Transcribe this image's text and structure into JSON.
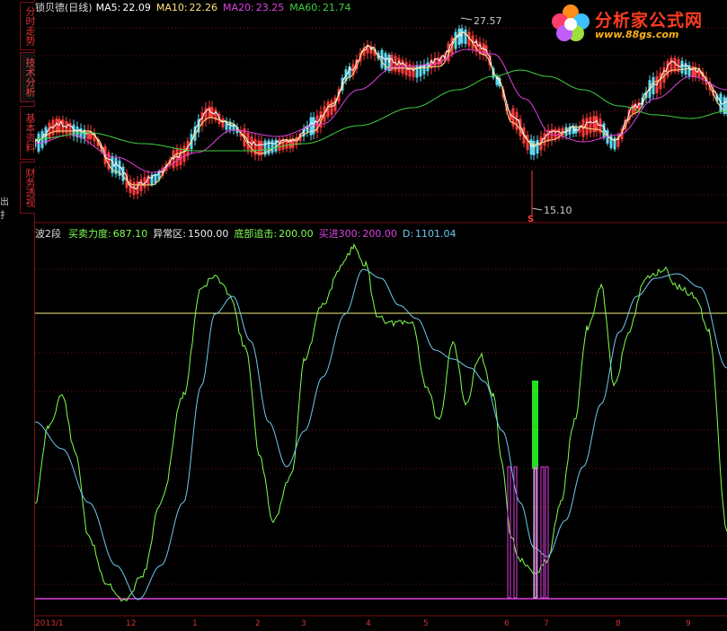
{
  "colors": {
    "background": "#000000",
    "border": "#7a1010",
    "white_line": "#ffffff",
    "magenta_line": "#e040e0",
    "green_line": "#40d040",
    "light_green": "#7fff50",
    "cyan_line": "#6fc8f0",
    "yellow_line": "#f0f080",
    "red_candle": "#ff3b3b",
    "cyan_candle": "#60d8f0",
    "green_bar": "#22e022"
  },
  "sidebar": {
    "tabs": [
      "分时走势",
      "技术分析",
      "基本资料",
      "财务透视"
    ],
    "active": "技术分析",
    "left_text": "出 扌"
  },
  "logo": {
    "name": "分析家公式网",
    "url": "www.88gs.com"
  },
  "price_panel": {
    "title": "锁贝德(日线)",
    "ma5_label": "MA5:",
    "ma5": "22.09",
    "ma10_label": "MA10:",
    "ma10": "22.26",
    "ma20_label": "MA20:",
    "ma20": "23.25",
    "ma60_label": "MA60:",
    "ma60": "21.74",
    "high_marker": "27.57",
    "low_marker": "15.10",
    "signal": "S"
  },
  "indicator_panel": {
    "title": "波2段",
    "buysell_label": "买卖力度:",
    "buysell": "687.10",
    "abnormal_label": "异常区:",
    "abnormal": "1500.00",
    "bottom_label": "底部追击:",
    "bottom": "200.00",
    "buyin_label": "买进300:",
    "buyin": "200.00",
    "d_label": "D:",
    "d": "1101.04"
  },
  "x_axis": {
    "labels": [
      "2013/1",
      "12",
      "1",
      "2",
      "3",
      "4",
      "5",
      "6",
      "7",
      "8",
      "9"
    ]
  }
}
